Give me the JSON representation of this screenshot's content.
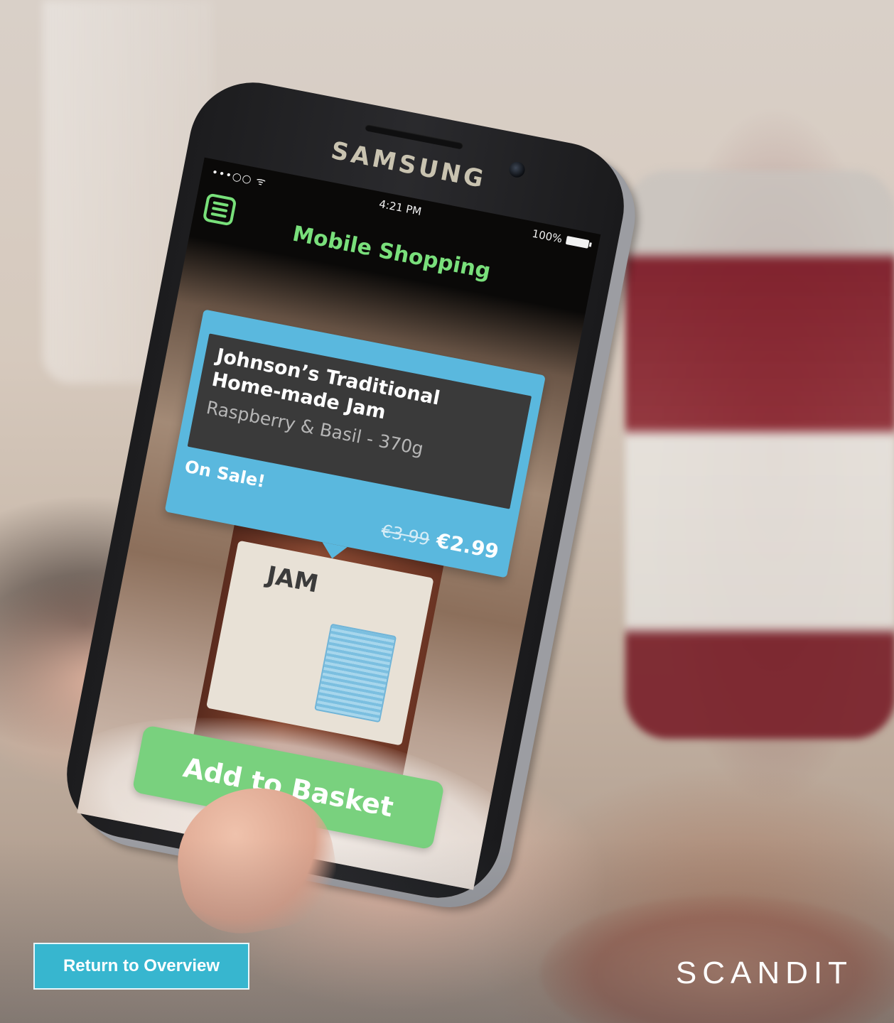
{
  "phone": {
    "brand": "SAMSUNG",
    "status": {
      "signal": "•••○○ ᯤ",
      "time": "4:21 PM",
      "battery": "100%"
    },
    "app_title": "Mobile Shopping",
    "menu_icon": "hamburger-menu-icon"
  },
  "product": {
    "name_line1": "Johnson’s Traditional",
    "name_line2": "Home-made Jam",
    "variant": "Raspberry & Basil - 370g",
    "sale_label": "On Sale!",
    "old_price": "€3.99",
    "new_price": "€2.99",
    "jar_label": "JAM"
  },
  "actions": {
    "add_to_basket": "Add to Basket",
    "return_to_overview": "Return to Overview"
  },
  "branding": {
    "logo": "SCANDIT"
  },
  "colors": {
    "accent_green": "#79d17e",
    "card_blue": "#5ab8de",
    "return_button": "#37b6cf"
  }
}
